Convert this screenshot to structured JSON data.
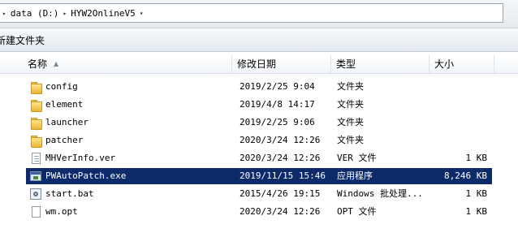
{
  "address": {
    "crumbs": [
      "data (D:)",
      "HYW2OnlineV5"
    ]
  },
  "toolbar": {
    "new_folder_label": "新建文件夹"
  },
  "columns": {
    "name": "名称",
    "date": "修改日期",
    "type": "类型",
    "size": "大小"
  },
  "files": [
    {
      "name": "config",
      "date": "2019/2/25 9:04",
      "type": "文件夹",
      "size": "",
      "icon": "folder-icon",
      "selected": false
    },
    {
      "name": "element",
      "date": "2019/4/8 14:17",
      "type": "文件夹",
      "size": "",
      "icon": "folder-icon",
      "selected": false
    },
    {
      "name": "launcher",
      "date": "2019/2/25 9:06",
      "type": "文件夹",
      "size": "",
      "icon": "folder-icon",
      "selected": false
    },
    {
      "name": "patcher",
      "date": "2020/3/24 12:26",
      "type": "文件夹",
      "size": "",
      "icon": "folder-icon",
      "selected": false
    },
    {
      "name": "MHVerInfo.ver",
      "date": "2020/3/24 12:26",
      "type": "VER 文件",
      "size": "1 KB",
      "icon": "document-icon",
      "selected": false
    },
    {
      "name": "PWAutoPatch.exe",
      "date": "2019/11/15 15:46",
      "type": "应用程序",
      "size": "8,246 KB",
      "icon": "application-icon",
      "selected": true
    },
    {
      "name": "start.bat",
      "date": "2015/4/26 19:15",
      "type": "Windows 批处理...",
      "size": "1 KB",
      "icon": "batch-file-icon",
      "selected": false
    },
    {
      "name": "wm.opt",
      "date": "2020/3/24 12:26",
      "type": "OPT 文件",
      "size": "1 KB",
      "icon": "blank-file-icon",
      "selected": false
    }
  ],
  "colors": {
    "selection": "#0d2a6b",
    "folder": "#e8b638"
  }
}
